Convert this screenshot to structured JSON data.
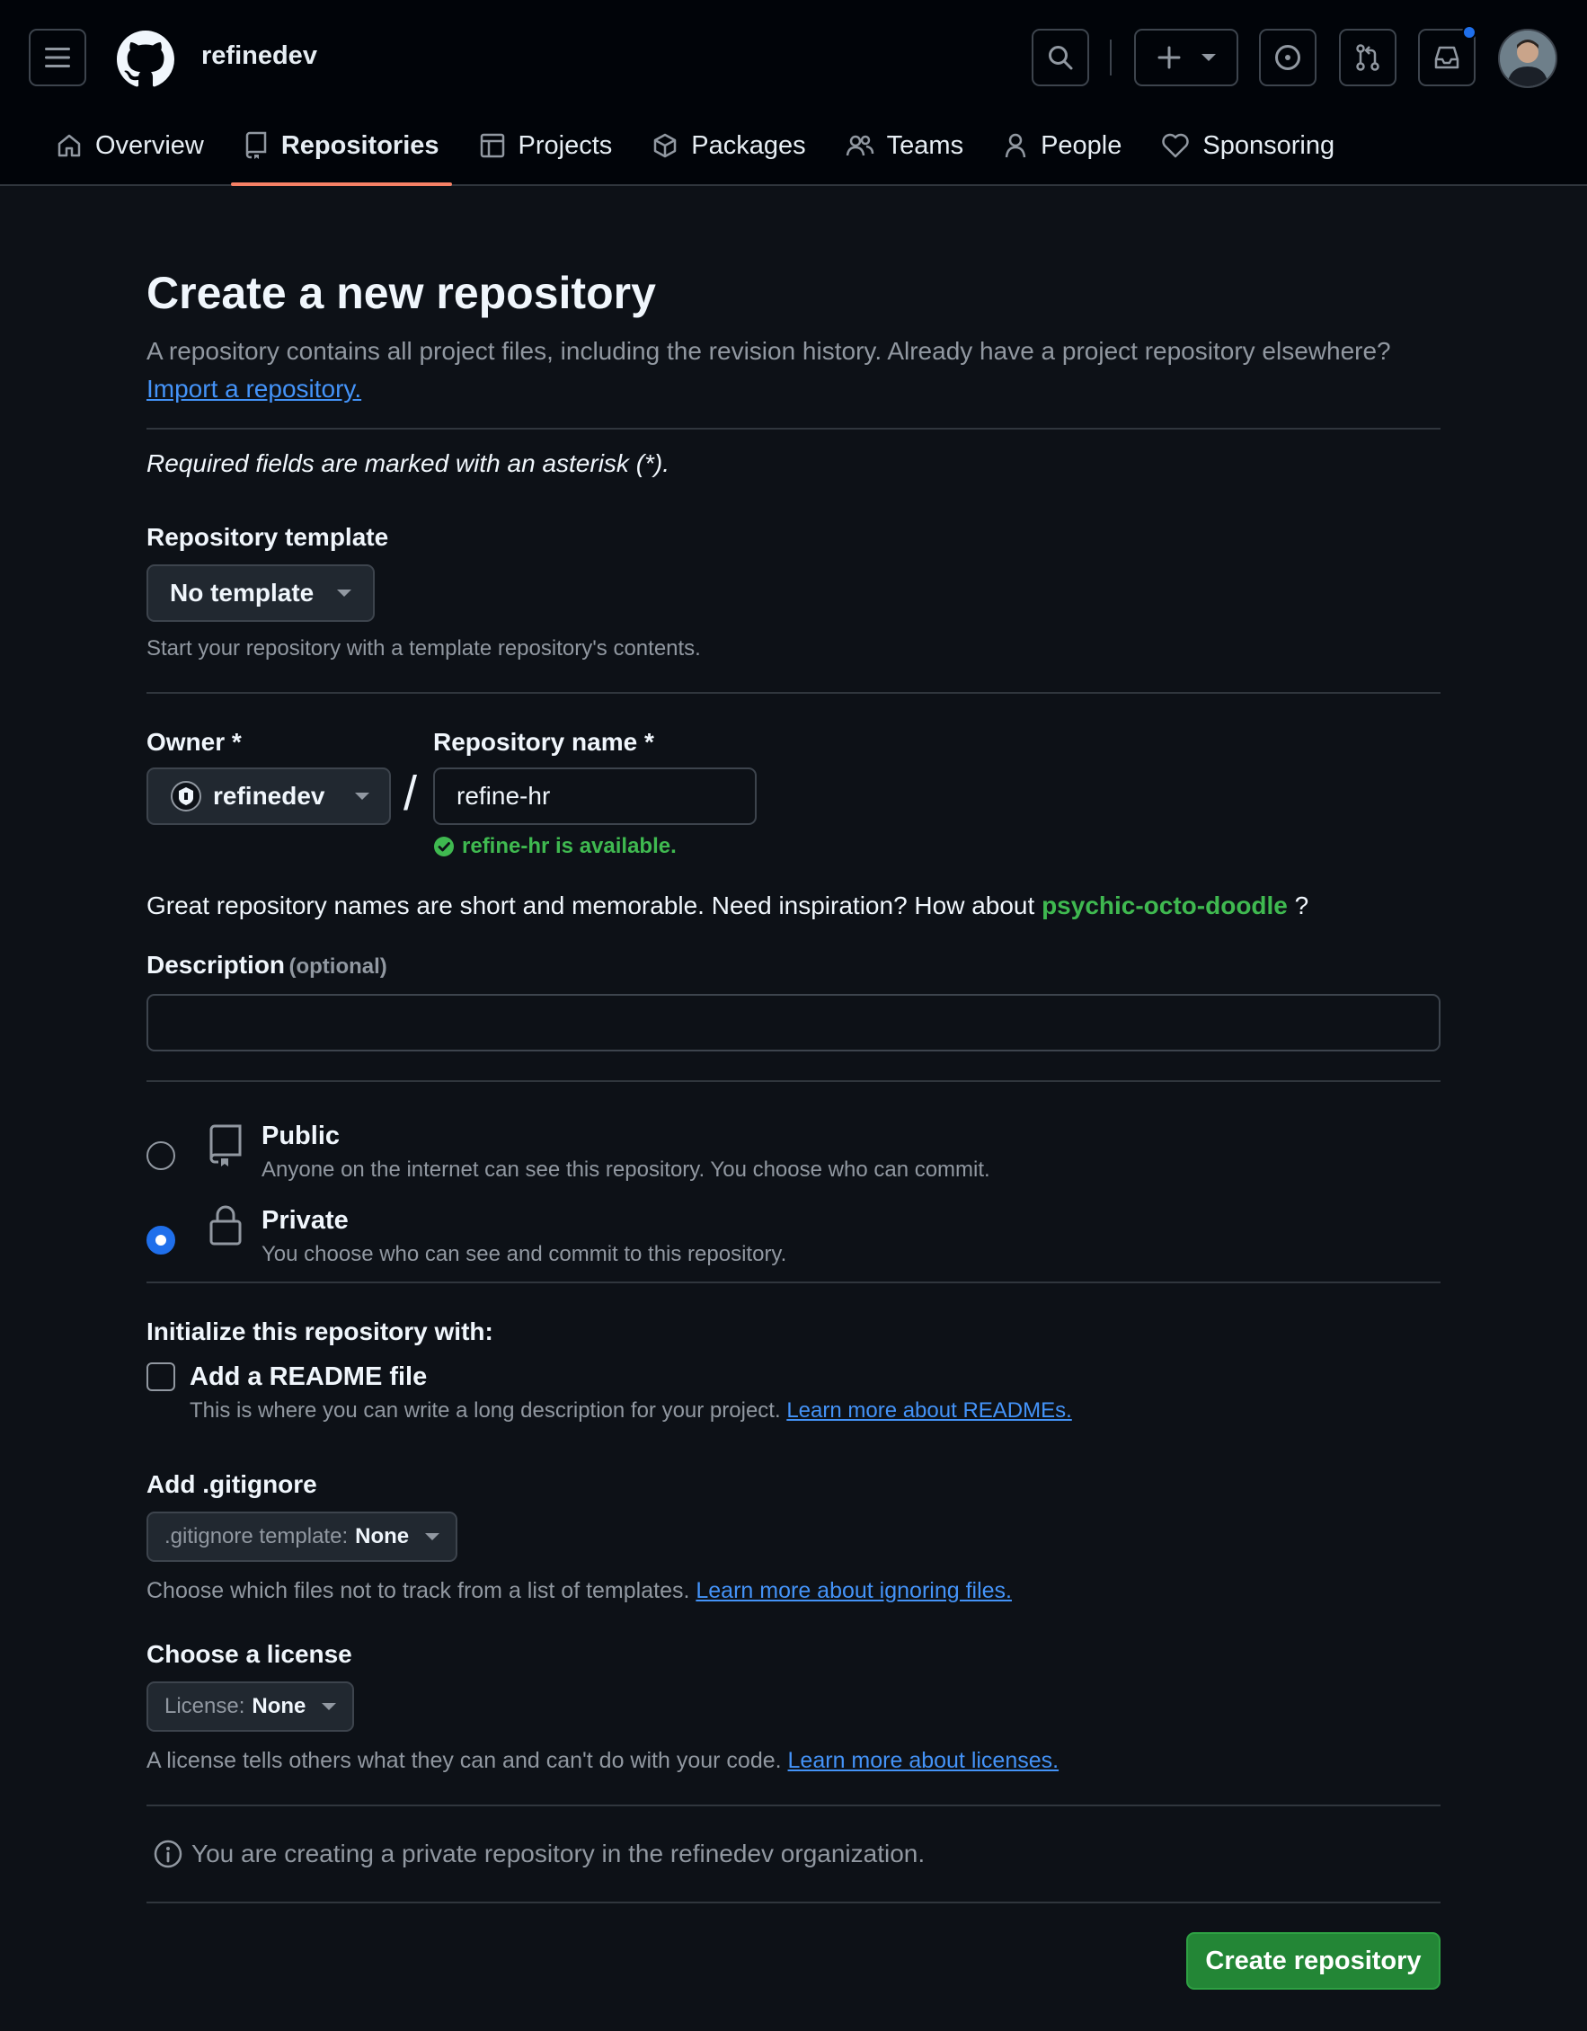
{
  "header": {
    "org_name": "refinedev",
    "tabs": [
      {
        "label": "Overview",
        "icon": "home-icon"
      },
      {
        "label": "Repositories",
        "icon": "repo-icon"
      },
      {
        "label": "Projects",
        "icon": "table-icon"
      },
      {
        "label": "Packages",
        "icon": "package-icon"
      },
      {
        "label": "Teams",
        "icon": "people-icon"
      },
      {
        "label": "People",
        "icon": "person-icon"
      },
      {
        "label": "Sponsoring",
        "icon": "heart-icon"
      }
    ],
    "active_tab": "Repositories"
  },
  "page": {
    "title": "Create a new repository",
    "subtitle": "A repository contains all project files, including the revision history. Already have a project repository elsewhere?",
    "import_link": "Import a repository.",
    "required_note": "Required fields are marked with an asterisk (*)."
  },
  "template": {
    "label": "Repository template",
    "value": "No template",
    "note": "Start your repository with a template repository's contents."
  },
  "owner": {
    "label": "Owner *",
    "value": "refinedev",
    "separator": "/"
  },
  "repo_name": {
    "label": "Repository name *",
    "value": "refine-hr",
    "availability": "refine-hr is available."
  },
  "inspiration": {
    "text": "Great repository names are short and memorable. Need inspiration? How about",
    "suggestion": "psychic-octo-doodle",
    "suffix": "?"
  },
  "description": {
    "label": "Description",
    "optional": "(optional)",
    "value": ""
  },
  "visibility": {
    "public_title": "Public",
    "public_desc": "Anyone on the internet can see this repository. You choose who can commit.",
    "private_title": "Private",
    "private_desc": "You choose who can see and commit to this repository.",
    "selected": "Private"
  },
  "init": {
    "heading": "Initialize this repository with:",
    "readme_label": "Add a README file",
    "readme_checked": false,
    "readme_desc": "This is where you can write a long description for your project.",
    "readme_link": "Learn more about READMEs."
  },
  "gitignore": {
    "label": "Add .gitignore",
    "prefix": ".gitignore template:",
    "value": "None",
    "note": "Choose which files not to track from a list of templates.",
    "link": "Learn more about ignoring files."
  },
  "license": {
    "label": "Choose a license",
    "prefix": "License:",
    "value": "None",
    "note": "A license tells others what they can and can't do with your code.",
    "link": "Learn more about licenses."
  },
  "info_message": "You are creating a private repository in the refinedev organization.",
  "submit_label": "Create repository",
  "colors": {
    "background": "#0d1117",
    "header_bg": "#010409",
    "accent_green": "#238636",
    "success_text": "#3fb950",
    "link_blue": "#4493f8",
    "tab_underline": "#f78166",
    "radio_selected": "#1f6feb"
  }
}
